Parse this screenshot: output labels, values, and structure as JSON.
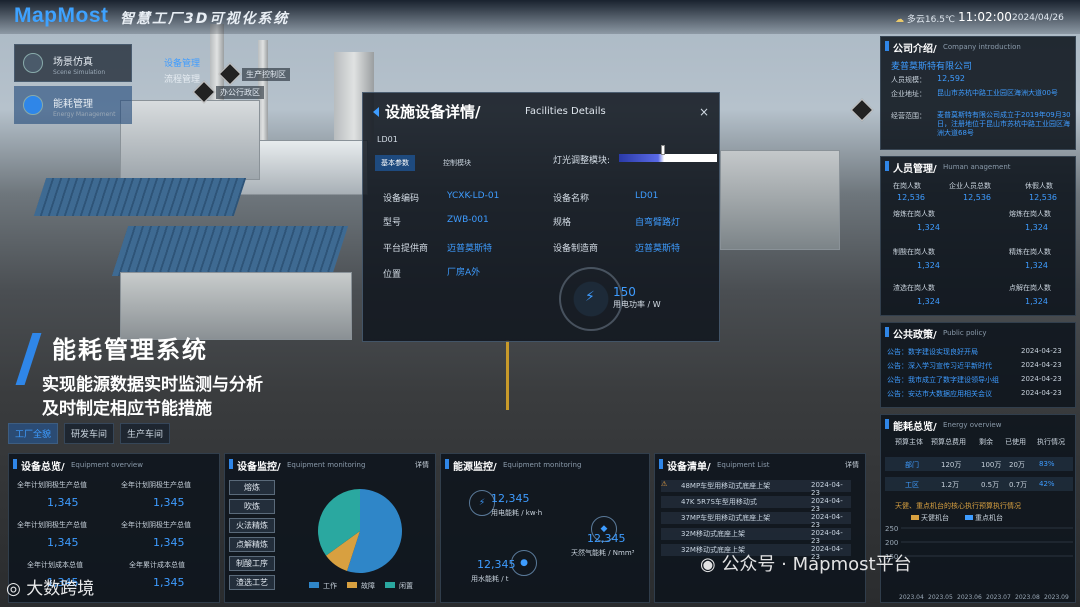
{
  "header": {
    "logo": "MapMost",
    "title": "智慧工厂3D可视化系统",
    "weather": "多云16.5℃",
    "time": "11:02:00",
    "date": "2024/04/26"
  },
  "nav": {
    "scene": "场景仿真",
    "scene_en": "Scene Simulation",
    "energy": "能耗管理",
    "energy_en": "Energy Management",
    "equip": "设备管理",
    "process": "流程管理"
  },
  "markers": {
    "prod": "生产控制区",
    "office": "办公行政区"
  },
  "modal": {
    "title": "设施设备详情/",
    "title_en": "Facilities Details",
    "id": "LD01",
    "tab_basic": "基本参数",
    "tab_control": "控制模块",
    "light": "灯光调整模块:",
    "fields": [
      {
        "label": "设备编码",
        "value": "YCXK-LD-01"
      },
      {
        "label": "设备名称",
        "value": "LD01"
      },
      {
        "label": "型号",
        "value": "ZWB-001"
      },
      {
        "label": "规格",
        "value": "自弯臂路灯"
      },
      {
        "label": "平台提供商",
        "value": "迈普莫斯特"
      },
      {
        "label": "设备制造商",
        "value": "迈普莫斯特"
      },
      {
        "label": "位置",
        "value": "厂房A外"
      }
    ],
    "power_value": "150",
    "power_label": "用电功率 / W",
    "close": "×"
  },
  "headline": {
    "title": "能耗管理系统",
    "line1": "实现能源数据实时监测与分析",
    "line2": "及时制定相应节能措施"
  },
  "floor_tabs": [
    "工厂全貌",
    "研发车间",
    "生产车间"
  ],
  "equip_overview": {
    "title": "设备总览/",
    "title_en": "Equipment overview",
    "cells": [
      {
        "label": "全年计划阴极生产总值",
        "value": "1,345"
      },
      {
        "label": "全年计划阴极生产总值",
        "value": "1,345"
      },
      {
        "label": "全年计划阴极生产总值",
        "value": "1,345"
      },
      {
        "label": "全年计划阴极生产总值",
        "value": "1,345"
      },
      {
        "label": "全年计划成本总值",
        "value": "1,345"
      },
      {
        "label": "全年累计成本总值",
        "value": "1,345"
      }
    ]
  },
  "equip_monitor": {
    "title": "设备监控/",
    "title_en": "Equipment monitoring",
    "detail": "详情",
    "buttons": [
      "熔炼",
      "吹炼",
      "火法精炼",
      "点解精炼",
      "制酸工序",
      "渣选工艺"
    ],
    "legend": [
      "工作",
      "故障",
      "闲置"
    ],
    "colors": {
      "work": "#2f86c8",
      "fault": "#d8a040",
      "idle": "#2aa8a0"
    }
  },
  "energy_monitor": {
    "title": "能源监控/",
    "title_en": "Equipment monitoring",
    "items": [
      {
        "value": "12,345",
        "label": "用电能耗 / kw·h"
      },
      {
        "value": "12,345",
        "label": "天然气能耗 / Nmm³"
      },
      {
        "value": "12,345",
        "label": "用水能耗 / t"
      }
    ]
  },
  "equip_list": {
    "title": "设备清单/",
    "title_en": "Equipment List",
    "detail": "详情",
    "rows": [
      {
        "name": "48MP车型用移动式底座上架",
        "date": "2024-04-23"
      },
      {
        "name": "47K 5R7S车型用移动式",
        "date": "2024-04-23"
      },
      {
        "name": "37MP车型用移动式底座上架",
        "date": "2024-04-23"
      },
      {
        "name": "32M移动式底座上架",
        "date": "2024-04-23"
      },
      {
        "name": "32M移动式底座上架",
        "date": "2024-04-23"
      }
    ]
  },
  "company": {
    "title": "公司介绍/",
    "title_en": "Company introduction",
    "name": "麦普莫斯特有限公司",
    "staff_label": "人员规模：",
    "staff": "12,592",
    "addr_label": "企业地址：",
    "addr": "昆山市苏杭中路工业园区海洲大道00号",
    "scope_label": "经营范围：",
    "scope": "麦普莫斯特有限公司成立于2019年09月30日，注册地位于昆山市苏杭中路工业园区海洲大道68号"
  },
  "hr": {
    "title": "人员管理/",
    "title_en": "Human anagement",
    "top": [
      {
        "label": "在岗人数",
        "value": "12,536"
      },
      {
        "label": "企业人员总数",
        "value": "12,536"
      },
      {
        "label": "休假人数",
        "value": "12,536"
      }
    ],
    "rows": [
      {
        "l": "熔炼在岗人数",
        "lv": "1,324",
        "r": "熔炼在岗人数",
        "rv": "1,324"
      },
      {
        "l": "制酸在岗人数",
        "lv": "1,324",
        "r": "精炼在岗人数",
        "rv": "1,324"
      },
      {
        "l": "渣选在岗人数",
        "lv": "1,324",
        "r": "点解在岗人数",
        "rv": "1,324"
      }
    ]
  },
  "policy": {
    "title": "公共政策/",
    "title_en": "Public policy",
    "rows": [
      {
        "t": "公告：数字建设实现良好开局",
        "d": "2024-04-23"
      },
      {
        "t": "公告：深入学习宣传习近平新时代",
        "d": "2024-04-23"
      },
      {
        "t": "公告：我市成立了数字建设领导小组",
        "d": "2024-04-23"
      },
      {
        "t": "公告：安达市大数据应用相关会议",
        "d": "2024-04-23"
      }
    ]
  },
  "energy_overview": {
    "title": "能耗总览/",
    "title_en": "Energy overview",
    "headers": [
      "预算主体",
      "预算总费用",
      "剩余",
      "已使用",
      "执行情况"
    ],
    "rows": [
      [
        "部门",
        "120万",
        "100万",
        "20万",
        "83%"
      ],
      [
        "工区",
        "1.2万",
        "0.5万",
        "0.7万",
        "42%"
      ]
    ],
    "chart_caption": "天健、重点机台的核心执行预算执行情况",
    "legend": [
      "天健机台",
      "重点机台"
    ]
  },
  "chart_data": {
    "type": "line",
    "x": [
      "2023.04",
      "2023.05",
      "2023.06",
      "2023.07",
      "2023.08",
      "2023.09"
    ],
    "yticks": [
      "250",
      "200",
      "150"
    ],
    "series": [
      {
        "name": "天健机台",
        "values": []
      },
      {
        "name": "重点机台",
        "values": []
      }
    ],
    "pie": [
      {
        "name": "工作",
        "value": 55
      },
      {
        "name": "故障",
        "value": 10
      },
      {
        "name": "闲置",
        "value": 35
      }
    ]
  },
  "watermark": {
    "wechat": "公众号 · Mapmost平台",
    "corner": "大数跨境"
  }
}
